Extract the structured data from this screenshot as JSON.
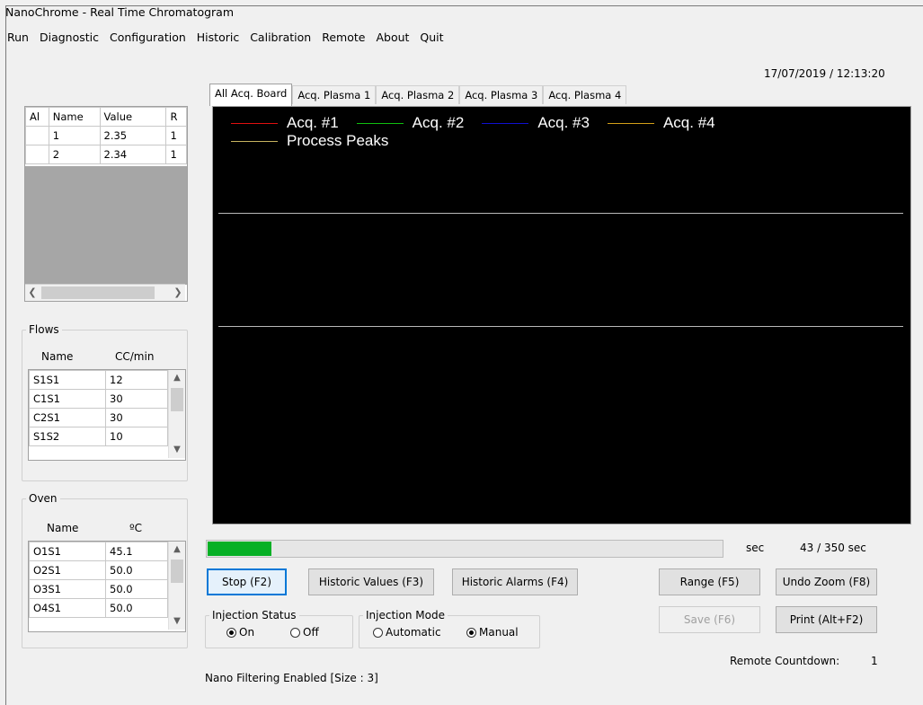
{
  "window": {
    "title": "NanoChrome - Real Time Chromatogram"
  },
  "menu": [
    "Run",
    "Diagnostic",
    "Configuration",
    "Historic",
    "Calibration",
    "Remote",
    "About",
    "Quit"
  ],
  "datetime": "17/07/2019 / 12:13:20",
  "alarm_table": {
    "headers": [
      "Al",
      "Name",
      "Value",
      "R"
    ],
    "rows": [
      [
        "",
        "1",
        "2.35",
        "1"
      ],
      [
        "",
        "2",
        "2.34",
        "1"
      ]
    ]
  },
  "flows": {
    "title": "Flows",
    "headers": [
      "Name",
      "CC/min"
    ],
    "rows": [
      [
        "S1S1",
        "12"
      ],
      [
        "C1S1",
        "30"
      ],
      [
        "C2S1",
        "30"
      ],
      [
        "S1S2",
        "10"
      ]
    ]
  },
  "oven": {
    "title": "Oven",
    "headers": [
      "Name",
      "ºC"
    ],
    "rows": [
      [
        "O1S1",
        "45.1"
      ],
      [
        "O2S1",
        "50.0"
      ],
      [
        "O3S1",
        "50.0"
      ],
      [
        "O4S1",
        "50.0"
      ]
    ]
  },
  "tabs": [
    "All Acq. Board",
    "Acq. Plasma 1",
    "Acq. Plasma 2",
    "Acq. Plasma 3",
    "Acq. Plasma 4"
  ],
  "active_tab": 0,
  "chart_legend": [
    {
      "label": "Acq. #1",
      "color": "#e01010"
    },
    {
      "label": "Acq. #2",
      "color": "#10c010"
    },
    {
      "label": "Acq. #3",
      "color": "#1010d0"
    },
    {
      "label": "Acq. #4",
      "color": "#d4a018"
    },
    {
      "label": "Process Peaks",
      "color": "#c8b460"
    }
  ],
  "chart_colors": {
    "background": "#000000",
    "gridline": "#b8b8b8"
  },
  "progress": {
    "fraction": 0.1229,
    "unit_label": "sec",
    "counter": "43 / 350  sec",
    "fill_color": "#06b025"
  },
  "buttons": {
    "stop": "Stop (F2)",
    "historic_values": "Historic Values (F3)",
    "historic_alarms": "Historic Alarms (F4)",
    "range": "Range (F5)",
    "undo_zoom": "Undo Zoom (F8)",
    "save": "Save (F6)",
    "print": "Print (Alt+F2)"
  },
  "injection_status": {
    "label": "Injection Status",
    "options": [
      "On",
      "Off"
    ],
    "selected": "On"
  },
  "injection_mode": {
    "label": "Injection Mode",
    "options": [
      "Automatic",
      "Manual"
    ],
    "selected": "Manual"
  },
  "remote_countdown": {
    "label": "Remote Countdown:",
    "value": "1"
  },
  "status_text": "Nano Filtering Enabled [Size : 3]"
}
